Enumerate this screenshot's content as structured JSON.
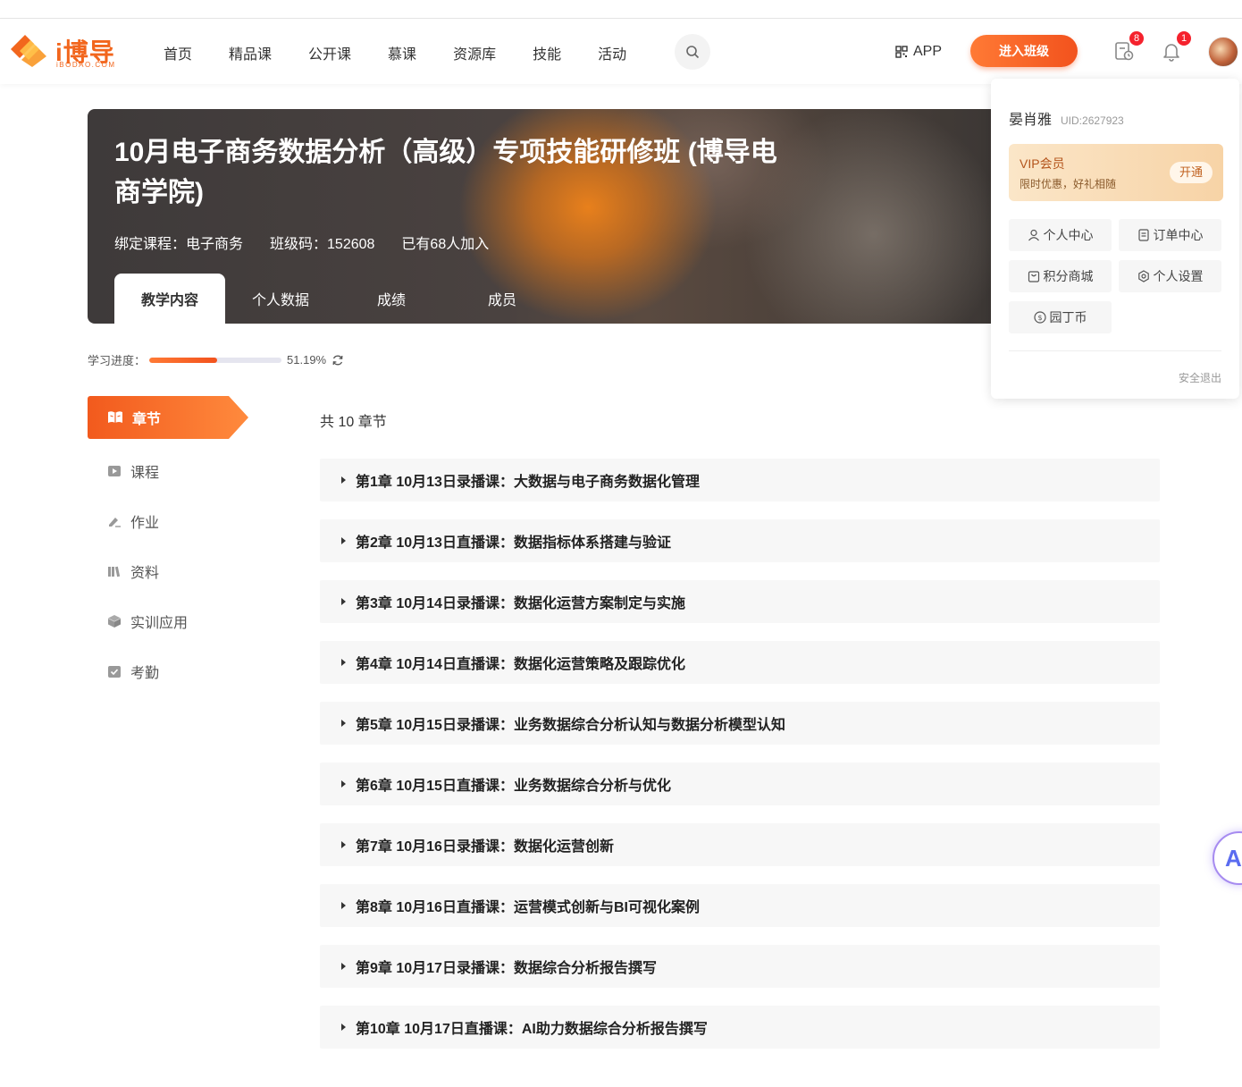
{
  "header": {
    "logo_text": "i博导",
    "logo_sub": "iBODAO.COM",
    "nav": [
      "首页",
      "精品课",
      "公开课",
      "慕课",
      "资源库",
      "技能",
      "活动"
    ],
    "app_label": "APP",
    "enter_class": "进入班级",
    "todo_badge": "8",
    "bell_badge": "1"
  },
  "banner": {
    "title": "10月电子商务数据分析（高级）专项技能研修班 (博导电商学院)",
    "course": "绑定课程：电子商务",
    "class_code": "班级码：152608",
    "joined": "已有68人加入",
    "tabs": [
      "教学内容",
      "个人数据",
      "成绩",
      "成员"
    ]
  },
  "progress": {
    "label": "学习进度：",
    "value_text": "51.19%",
    "fraction": 0.5119
  },
  "sidemenu": [
    "章节",
    "课程",
    "作业",
    "资料",
    "实训应用",
    "考勤"
  ],
  "chapters": {
    "count_text": "共 10 章节",
    "items": [
      "第1章 10月13日录播课：大数据与电子商务数据化管理",
      "第2章 10月13日直播课：数据指标体系搭建与验证",
      "第3章 10月14日录播课：数据化运营方案制定与实施",
      "第4章 10月14日直播课：数据化运营策略及跟踪优化",
      "第5章 10月15日录播课：业务数据综合分析认知与数据分析模型认知",
      "第6章 10月15日直播课：业务数据综合分析与优化",
      "第7章 10月16日录播课：数据化运营创新",
      "第8章 10月16日直播课：运营模式创新与BI可视化案例",
      "第9章 10月17日录播课：数据综合分析报告撰写",
      "第10章 10月17日直播课：AI助力数据综合分析报告撰写"
    ]
  },
  "dropdown": {
    "name": "晏肖雅",
    "uid": "UID:2627923",
    "vip_title": "VIP会员",
    "vip_sub": "限时优惠，好礼相随",
    "vip_button": "开通",
    "items": [
      "个人中心",
      "订单中心",
      "积分商城",
      "个人设置",
      "园丁币"
    ],
    "logout": "安全退出"
  },
  "float_button": "A",
  "colors": {
    "accent": "#f2661d",
    "badge": "#f5222d"
  }
}
